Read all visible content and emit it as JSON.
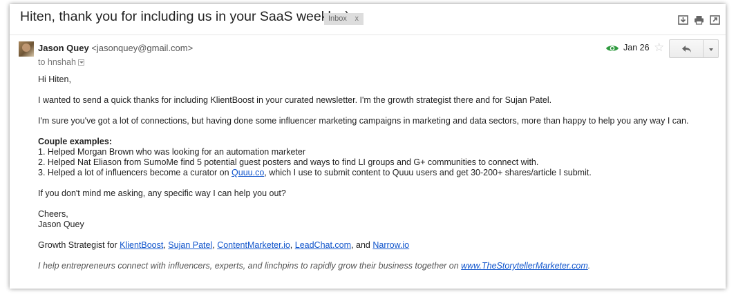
{
  "email": {
    "subject": "Hiten, thank you for including us in your SaaS weekly :)",
    "label": "Inbox",
    "label_close": "x",
    "sender_name": "Jason Quey",
    "sender_email": "<jasonquey@gmail.com>",
    "to_text": "to hnshah",
    "date": "Jan 26",
    "star_glyph": "☆"
  },
  "icons": {
    "download": "download-icon",
    "print": "print-icon",
    "new_window": "new-window-icon",
    "eye": "eye-icon",
    "star": "star-icon",
    "reply": "reply-icon",
    "more": "chevron-down-icon"
  },
  "colors": {
    "link": "#1155cc",
    "eye": "#2e9a3e",
    "chip": "#dddddd"
  },
  "body": {
    "greeting": "Hi Hiten,",
    "p1": "I wanted to send a quick thanks for including KlientBoost in your curated newsletter. I'm the growth strategist there and for Sujan Patel.",
    "p2": "I'm sure you've got a lot of connections, but having done some influencer marketing campaigns in marketing and data sectors, more than happy to help you any way I can.",
    "examples_heading": "Couple examples:",
    "ex1": "1. Helped Morgan Brown who was looking for an automation marketer",
    "ex2": "2. Helped Nat Eliason from SumoMe find 5 potential guest posters and ways to find LI groups and G+ communities to connect with.",
    "ex3_pre": "3. Helped a lot of influencers become a curator on ",
    "ex3_link": "Quuu.co",
    "ex3_post": ", which I use to submit content to Quuu users and get 30-200+ shares/article I submit.",
    "question": "If you don't mind me asking, any specific way I can help you out?",
    "signoff": "Cheers,",
    "signname": "Jason Quey",
    "sig_pre": "Growth Strategist for ",
    "sig_links": [
      "KlientBoost",
      "Sujan Patel",
      "ContentMarketer.io",
      "LeadChat.com",
      "Narrow.io"
    ],
    "sig_sep1": ", ",
    "sig_sep_and": ", and ",
    "tagline_pre": "I help entrepreneurs connect with influencers, experts, and linchpins to rapidly grow their business together on ",
    "tagline_link": "www.TheStorytellerMarketer.com",
    "tagline_post": "."
  }
}
